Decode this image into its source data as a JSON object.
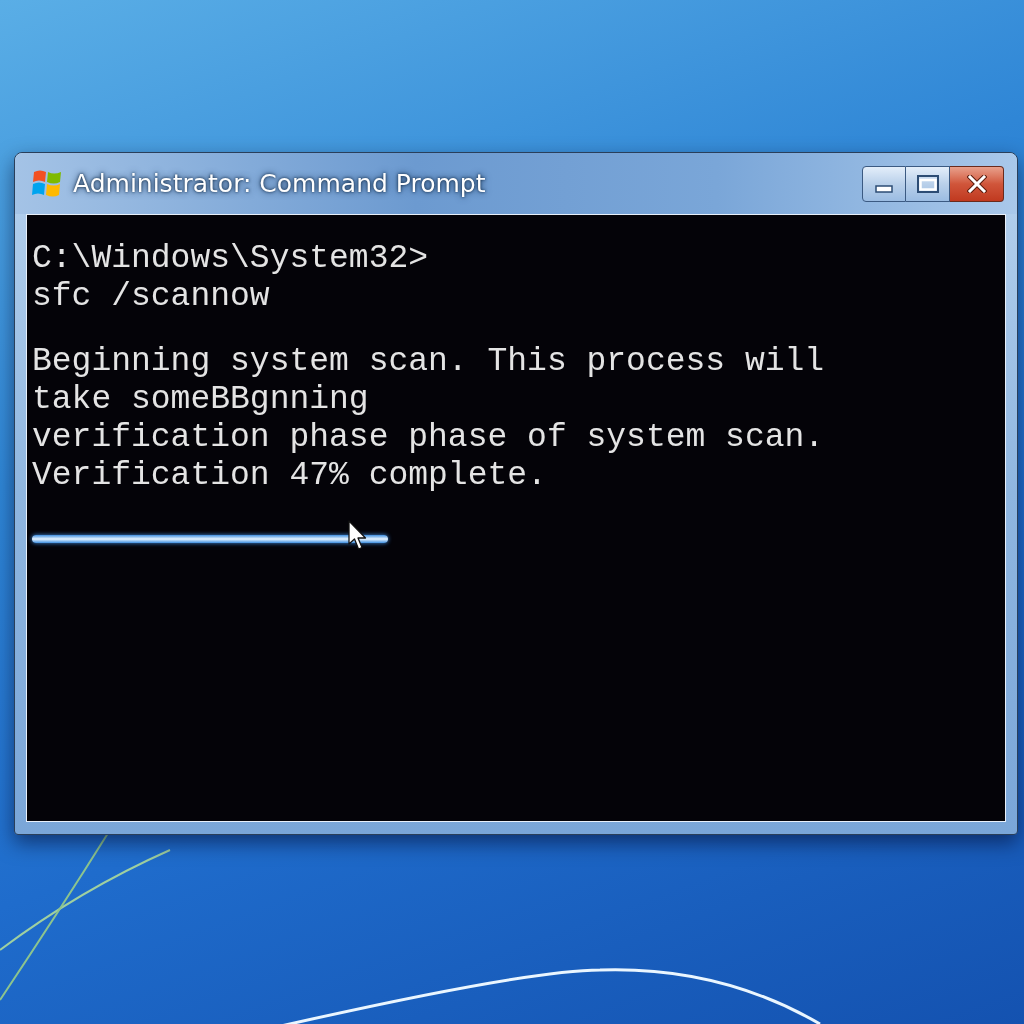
{
  "window": {
    "title": "Administrator: Command Prompt",
    "buttons": [
      {
        "kind": "minimize"
      },
      {
        "kind": "maximize"
      },
      {
        "kind": "close"
      }
    ]
  },
  "console": {
    "blocks": [
      [
        "C:\\Windows\\System32>",
        "sfc /scannow"
      ],
      [
        "Beginning system scan. This process will",
        "take someBBgnning",
        "verification phase phase of system scan.",
        "Verification 47% complete."
      ]
    ],
    "progress": {
      "level": 0.37
    }
  }
}
